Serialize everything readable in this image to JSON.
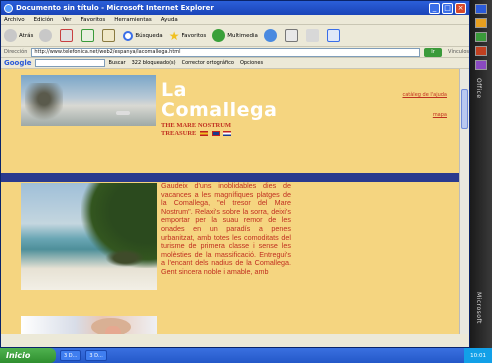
{
  "window": {
    "title": "Documento sin título - Microsoft Internet Explorer",
    "controls": {
      "minimize": "_",
      "maximize": "□",
      "close": "×"
    }
  },
  "menu": [
    "Archivo",
    "Edición",
    "Ver",
    "Favoritos",
    "Herramientas",
    "Ayuda"
  ],
  "toolbar": {
    "back": "Atrás",
    "search": "Búsqueda",
    "favorites": "Favoritos",
    "multimedia": "Multimedia"
  },
  "address": {
    "label": "Dirección",
    "url": "http://www.telefonica.net/web2/espanya/lacomallega.html",
    "go": "Ir",
    "links": "Vínculos"
  },
  "googlebar": {
    "logo": "Google",
    "search_button": "Buscar",
    "blocked": "322 bloqueado(s)",
    "spell": "Corrector ortográfico",
    "options": "Opciones"
  },
  "page": {
    "heading_line1": "La",
    "heading_line2": "Comallega",
    "subtitle_line1": "THE MARE NOSTRUM",
    "subtitle_line2": "TREASURE",
    "link1": "catàleg de l'ajuda",
    "link2": "mapa",
    "body": "Gaudeix d'uns inoblidables dies de vacances a les magnífiques platges de la Comallega, \"el tresor del Mare Nostrum\". Relaxi's sobre la sorra, deixi's emportar per la suau remor de les onades en un paradís a penes urbanitzat, amb totes les comoditats del turisme de primera classe i sense les molèsties de la massificació. Entregui's a l'encant dels nadius de la Comallega. Gent sincera noble i amable, amb"
  },
  "officebar": {
    "label_top": "Office",
    "label_bottom": "Microsoft"
  },
  "taskbar": {
    "start": "Inicio",
    "task1": "3 D...",
    "task2": "3 D...",
    "clock": "10:01"
  },
  "colors": {
    "page_bg": "#f5d580",
    "accent_red": "#c03020",
    "band_blue": "#2a3a8e"
  }
}
